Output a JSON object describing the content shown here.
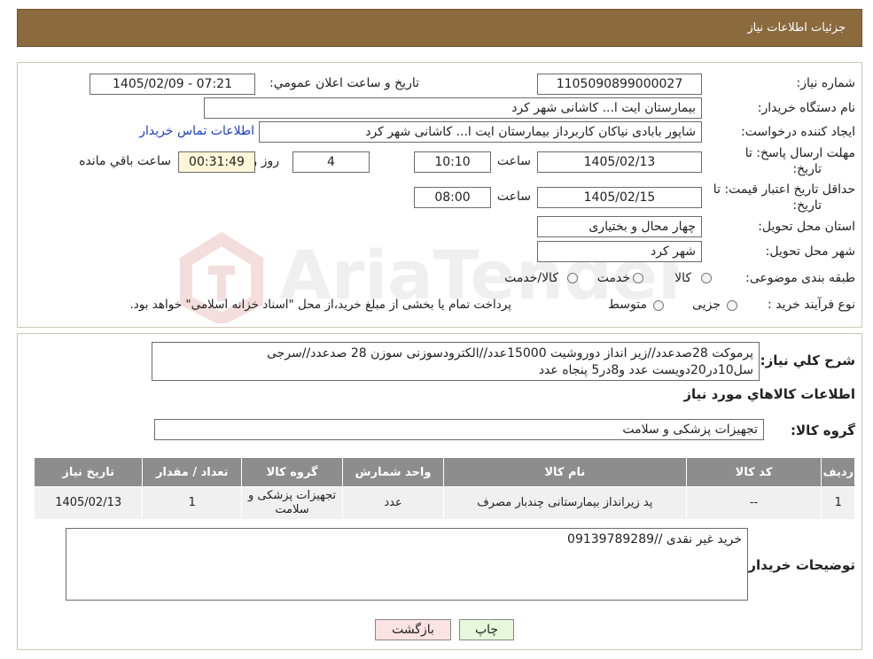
{
  "header": {
    "title": "جزئیات اطلاعات نیاز"
  },
  "form": {
    "need_number_label": "شماره نیاز:",
    "need_number": "1105090899000027",
    "announce_label": "تاریخ و ساعت اعلان عمومي:",
    "announce_value": "1405/02/09 - 07:21",
    "buyer_org_label": "نام دستگاه خریدار:",
    "buyer_org": "بیمارستان ایت ا... کاشانی شهر کرد",
    "requester_label": "ایجاد کننده درخواست:",
    "requester": "شاپور بابادی نیاکان کاربرداز بیمارستان ایت ا... کاشانی شهر کرد",
    "contact_link": "اطلاعات تماس خریدار",
    "deadline_label_1": "مهلت ارسال پاسخ: تا",
    "deadline_label_2": "تاریخ:",
    "deadline_date": "1405/02/13",
    "time_label": "ساعت",
    "deadline_time": "10:10",
    "days_value": "4",
    "days_label": "روز و",
    "remaining_time": "00:31:49",
    "remaining_label": "ساعت باقي مانده",
    "validity_label_1": "حداقل تاریخ اعتبار قیمت: تا",
    "validity_label_2": "تاریخ:",
    "validity_date": "1405/02/15",
    "validity_time": "08:00",
    "province_label": "استان محل تحویل:",
    "province": "چهار محال و بختیاری",
    "city_label": "شهر محل تحویل:",
    "city": "شهر کرد",
    "category_label": "طبقه بندی موضوعی:",
    "category_options": [
      "کالا",
      "خدمت",
      "کالا/خدمت"
    ],
    "process_label": "نوع فرآیند خرید :",
    "process_options": [
      "جزیی",
      "متوسط"
    ],
    "process_note": "پرداخت تمام یا بخشی از مبلغ خرید،از محل \"اسناد خزانه اسلامی\" خواهد بود."
  },
  "summary": {
    "label": "شرح کلي نياز:",
    "text_line1": "پرموکت 28صدعدد//زیر انداز دوروشیت 15000عدد//الکترودسوزنی سوزن 28 صدعدد//سرجی",
    "text_line2": "سل10در20دویست عدد و8در5 پنجاه عدد"
  },
  "items_section": {
    "title": "اطلاعات کالاهاي مورد نياز",
    "group_label": "گروه کالا:",
    "group_value": "تجهیزات پزشکی و سلامت"
  },
  "table": {
    "headers": [
      "ردیف",
      "کد کالا",
      "نام کالا",
      "واحد شمارش",
      "گروه کالا",
      "تعداد / مقدار",
      "تاریخ نیاز"
    ],
    "rows": [
      [
        "1",
        "--",
        "پد زیرانداز بیمارستانی چندبار مصرف",
        "عدد",
        "تجهیزات پزشکی و سلامت",
        "1",
        "1405/02/13"
      ]
    ]
  },
  "buyer_notes": {
    "label": "توضیحات خریدار:",
    "text": "خرید غیر نقدی //09139789289"
  },
  "buttons": {
    "print": "چاپ",
    "back": "بازگشت"
  },
  "watermark": {
    "text": "AriaTender.neT"
  },
  "colors": {
    "header_bg": "#8b6a3e",
    "table_header_bg": "#8d8d8d",
    "link": "#1a3cc8",
    "print_btn": "#e6f7dc",
    "back_btn": "#fbe3e3"
  }
}
